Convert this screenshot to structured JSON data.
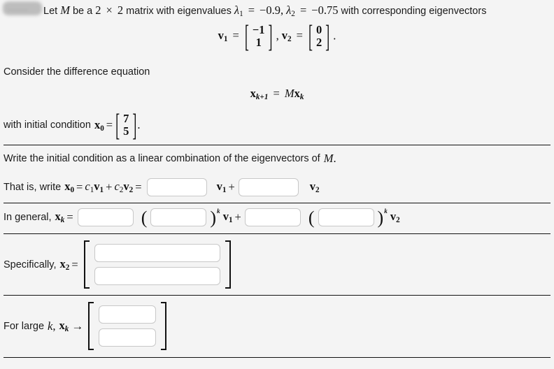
{
  "page": {
    "background_color": "#f4f4f4",
    "text_color": "#1a1a1a",
    "rule_color": "#121212"
  },
  "redaction": {
    "label": "redacted-name",
    "ghost_text": "........"
  },
  "statement": {
    "lead_text": "Let",
    "matrix_symbol": "M",
    "mid_text_1": "be a",
    "dim_rows": "2",
    "times_symbol": "×",
    "dim_cols": "2",
    "mid_text_2": "matrix with eigenvalues",
    "lambda1_symbol": "λ",
    "lambda1_index": "1",
    "equals": "=",
    "lambda1_value": "−0.9",
    "comma": ",",
    "lambda2_symbol": "λ",
    "lambda2_index": "2",
    "lambda2_value": "−0.75",
    "tail_text": "with corresponding eigenvectors",
    "v1_label": "v",
    "v1_index": "1",
    "v1_components": [
      "−1",
      "1"
    ],
    "separator": ",",
    "v2_label": "v",
    "v2_index": "2",
    "v2_components": [
      "0",
      "2"
    ],
    "period": "."
  },
  "difference_equation": {
    "intro_text": "Consider the difference equation",
    "equation": {
      "lhs_symbol": "x",
      "lhs_sub": "k+1",
      "equals": "=",
      "matrix_symbol": "M",
      "rhs_symbol": "x",
      "rhs_sub": "k"
    },
    "initial_condition": {
      "prefix_text": "with initial condition",
      "symbol": "x",
      "sub": "0",
      "equals": "=",
      "components": [
        "7",
        "5"
      ],
      "period": "."
    }
  },
  "sections": {
    "linear_combination": {
      "instruction": "Write the initial condition as a linear combination of the eigenvectors of",
      "instruction_symbol": "M",
      "instruction_period": ".",
      "prompt_text": "That is, write",
      "x0_symbol": "x",
      "x0_sub": "0",
      "equals_1": "=",
      "expr_c1": "c",
      "expr_c1_sub": "1",
      "expr_v1": "v",
      "expr_v1_sub": "1",
      "plus": "+",
      "expr_c2": "c",
      "expr_c2_sub": "2",
      "expr_v2": "v",
      "expr_v2_sub": "2",
      "equals_2": "=",
      "input_c1_value": "",
      "input_c1_placeholder": "",
      "after_input_1_v": "v",
      "after_input_1_sub": "1",
      "after_input_1_plus": "+",
      "input_c2_value": "",
      "input_c2_placeholder": "",
      "after_input_2_v": "v",
      "after_input_2_sub": "2"
    },
    "general_formula": {
      "prompt_text": "In general,",
      "xk_symbol": "x",
      "xk_sub": "k",
      "equals": "=",
      "input_coef1_value": "",
      "open_paren_1": "(",
      "input_base1_value": "",
      "close_paren_1": ")",
      "exponent_1": "k",
      "v1_symbol": "v",
      "v1_sub": "1",
      "plus": "+",
      "input_coef2_value": "",
      "open_paren_2": "(",
      "input_base2_value": "",
      "close_paren_2": ")",
      "exponent_2": "k",
      "v2_symbol": "v",
      "v2_sub": "2"
    },
    "specific_value": {
      "prompt_text": "Specifically,",
      "x_symbol": "x",
      "x_sub": "2",
      "equals": "=",
      "input_row1_value": "",
      "input_row2_value": ""
    },
    "limit_value": {
      "prompt_text_1": "For large",
      "k_symbol": "k",
      "comma": ",",
      "x_symbol": "x",
      "x_sub": "k",
      "arrow": "→",
      "input_row1_value": "",
      "input_row2_value": ""
    }
  }
}
